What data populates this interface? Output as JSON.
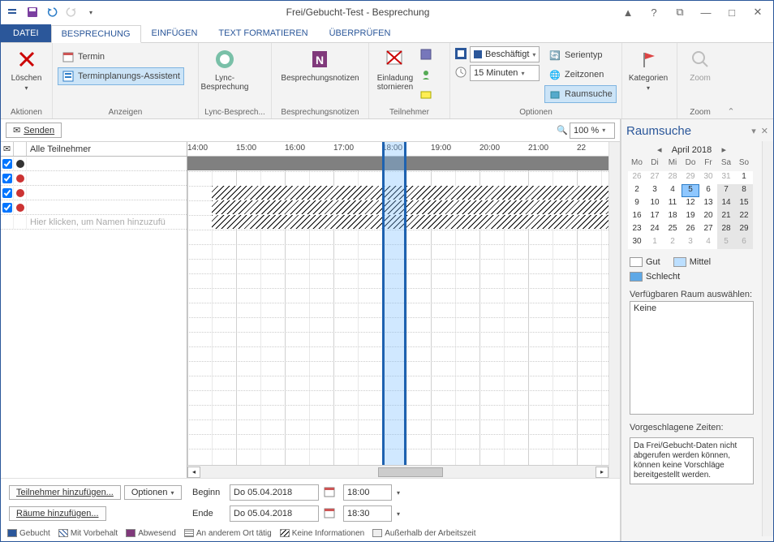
{
  "window": {
    "title": "Frei/Gebucht-Test - Besprechung"
  },
  "tabs": {
    "file": "DATEI",
    "items": [
      "BESPRECHUNG",
      "EINFÜGEN",
      "TEXT FORMATIEREN",
      "ÜBERPRÜFEN"
    ],
    "active": 0
  },
  "ribbon": {
    "aktionen": {
      "label": "Aktionen",
      "delete": "Löschen"
    },
    "anzeigen": {
      "label": "Anzeigen",
      "termin": "Termin",
      "assist": "Terminplanungs-Assistent"
    },
    "lync": {
      "label": "Lync-Besprech...",
      "btn": "Lync-\nBesprechung"
    },
    "notes": {
      "label": "Besprechungsnotizen",
      "btn": "Besprechungsnotizen"
    },
    "teilnehmer": {
      "label": "Teilnehmer",
      "cancel": "Einladung\nstornieren"
    },
    "optionen": {
      "label": "Optionen",
      "status": "Beschäftigt",
      "reminder": "15 Minuten",
      "serientyp": "Serientyp",
      "zeitzonen": "Zeitzonen",
      "raumsuche": "Raumsuche"
    },
    "kategorien": {
      "label": " ",
      "btn": "Kategorien"
    },
    "zoom": {
      "label": "Zoom",
      "btn": "Zoom"
    }
  },
  "toolbar": {
    "send": "Senden",
    "zoom_value": "100 %"
  },
  "timeline": {
    "hours": [
      "14:00",
      "15:00",
      "16:00",
      "17:00",
      "18:00",
      "19:00",
      "20:00",
      "21:00",
      "22"
    ],
    "sel_start_hour": 18.0,
    "sel_end_hour": 18.5
  },
  "attendees": {
    "header": "Alle Teilnehmer",
    "rows": [
      {
        "type": "organizer",
        "checked": true
      },
      {
        "type": "required",
        "checked": true
      },
      {
        "type": "required",
        "checked": true
      },
      {
        "type": "required",
        "checked": true
      }
    ],
    "add_placeholder": "Hier klicken, um Namen hinzuzufü"
  },
  "bottom": {
    "add_attendees": "Teilnehmer hinzufügen...",
    "options": "Optionen",
    "add_rooms": "Räume hinzufügen...",
    "begin_label": "Beginn",
    "end_label": "Ende",
    "date": "Do 05.04.2018",
    "start_time": "18:00",
    "end_time": "18:30"
  },
  "legend": {
    "booked": "Gebucht",
    "tentative": "Mit Vorbehalt",
    "absent": "Abwesend",
    "elsewhere": "An anderem Ort tätig",
    "noinfo": "Keine Informationen",
    "outside": "Außerhalb der Arbeitszeit"
  },
  "roomfinder": {
    "title": "Raumsuche",
    "month": "April 2018",
    "dow": [
      "Mo",
      "Di",
      "Mi",
      "Do",
      "Fr",
      "Sa",
      "So"
    ],
    "grid": [
      [
        {
          "n": 26,
          "o": true
        },
        {
          "n": 27,
          "o": true
        },
        {
          "n": 28,
          "o": true
        },
        {
          "n": 29,
          "o": true
        },
        {
          "n": 30,
          "o": true
        },
        {
          "n": 31,
          "o": true
        },
        {
          "n": 1
        }
      ],
      [
        {
          "n": 2
        },
        {
          "n": 3
        },
        {
          "n": 4
        },
        {
          "n": 5,
          "sel": true
        },
        {
          "n": 6
        },
        {
          "n": 7,
          "hl": true
        },
        {
          "n": 8,
          "hl": true
        }
      ],
      [
        {
          "n": 9
        },
        {
          "n": 10
        },
        {
          "n": 11
        },
        {
          "n": 12
        },
        {
          "n": 13
        },
        {
          "n": 14,
          "hl": true
        },
        {
          "n": 15,
          "hl": true
        }
      ],
      [
        {
          "n": 16
        },
        {
          "n": 17
        },
        {
          "n": 18
        },
        {
          "n": 19
        },
        {
          "n": 20
        },
        {
          "n": 21,
          "hl": true
        },
        {
          "n": 22,
          "hl": true
        }
      ],
      [
        {
          "n": 23
        },
        {
          "n": 24
        },
        {
          "n": 25
        },
        {
          "n": 26
        },
        {
          "n": 27
        },
        {
          "n": 28,
          "hl": true
        },
        {
          "n": 29,
          "hl": true
        }
      ],
      [
        {
          "n": 30
        },
        {
          "n": 1,
          "o": true
        },
        {
          "n": 2,
          "o": true
        },
        {
          "n": 3,
          "o": true
        },
        {
          "n": 4,
          "o": true
        },
        {
          "n": 5,
          "o": true,
          "hl": true
        },
        {
          "n": 6,
          "o": true,
          "hl": true
        }
      ]
    ],
    "good": "Gut",
    "medium": "Mittel",
    "bad": "Schlecht",
    "choose_room": "Verfügbaren Raum auswählen:",
    "none": "Keine",
    "suggested_times": "Vorgeschlagene Zeiten:",
    "msg": "Da Frei/Gebucht-Daten nicht abgerufen werden können, können keine Vorschläge bereitgestellt werden."
  }
}
